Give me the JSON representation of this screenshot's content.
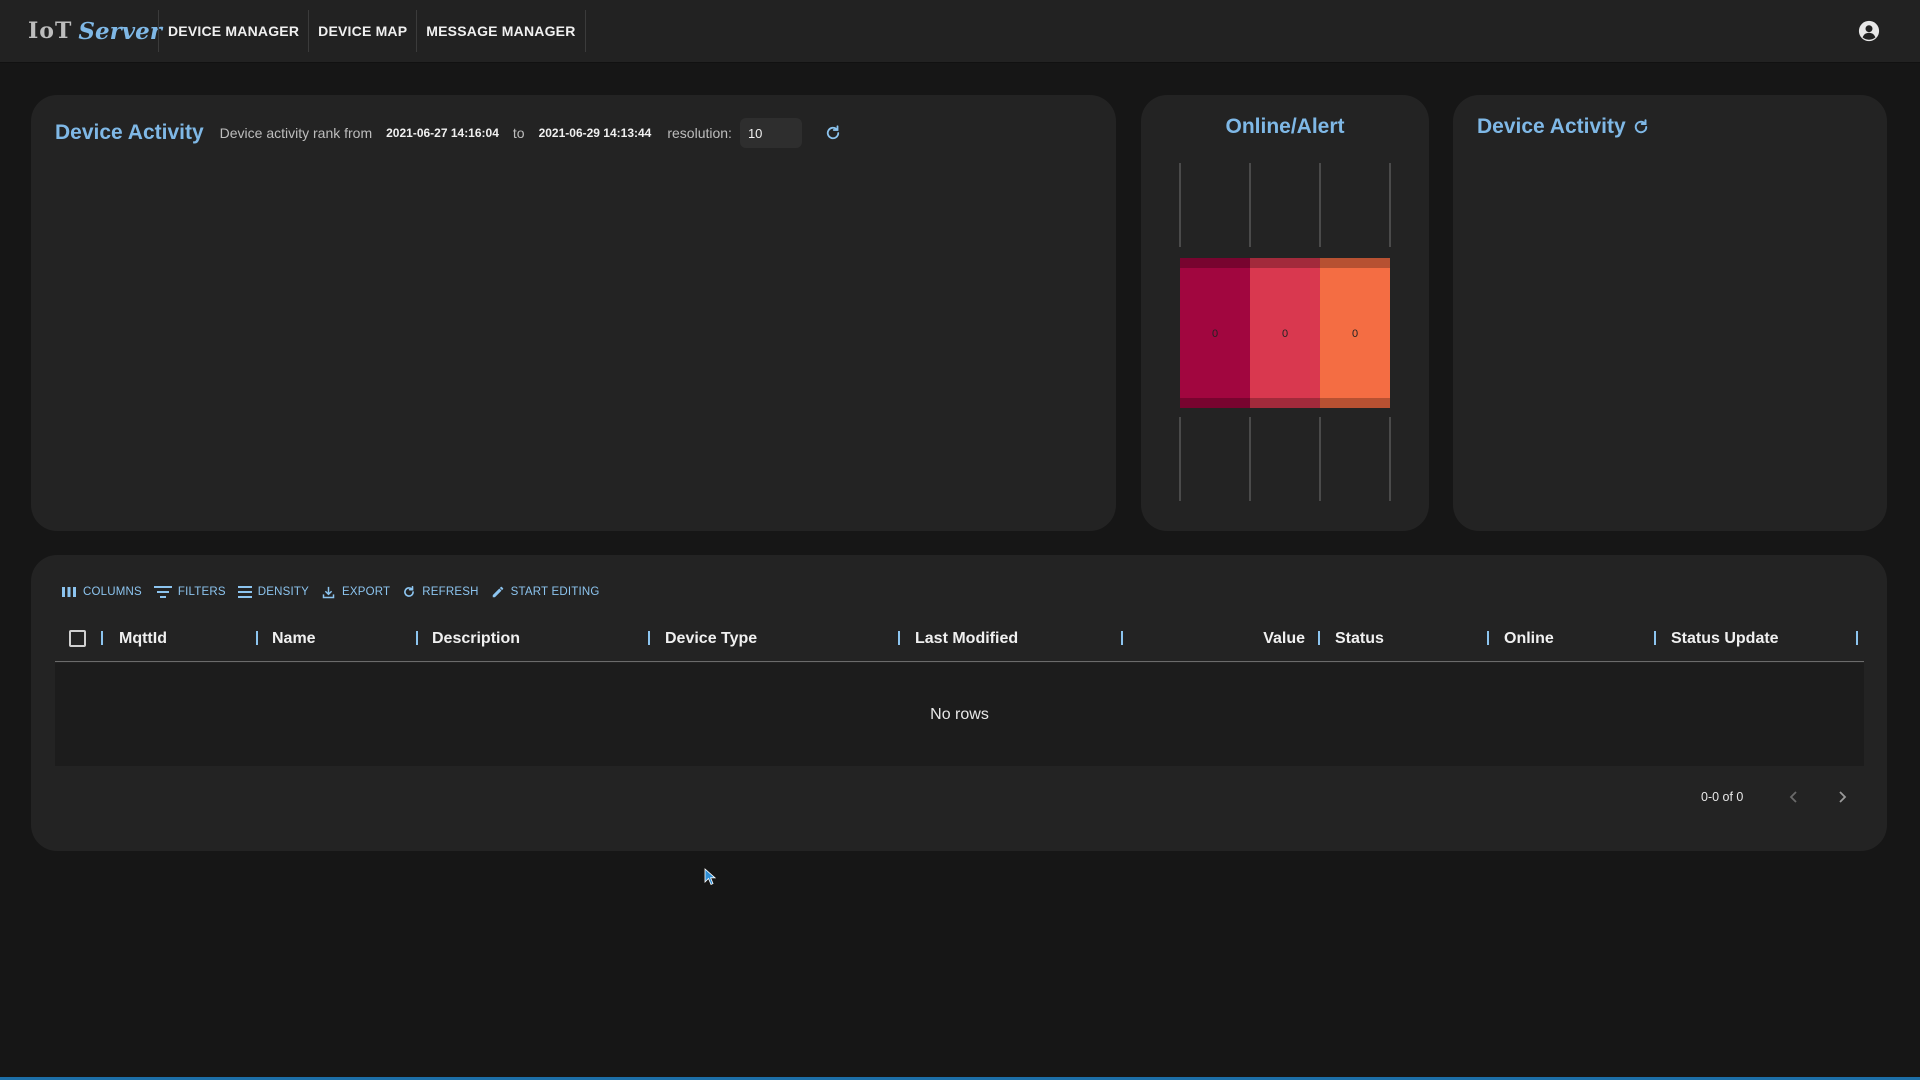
{
  "brand": {
    "prefix": "IoT",
    "suffix": "Server"
  },
  "nav": [
    {
      "label": "DEVICE MANAGER"
    },
    {
      "label": "DEVICE MAP"
    },
    {
      "label": "MESSAGE MANAGER"
    }
  ],
  "account_icon": "account-circle-icon",
  "device_activity": {
    "title": "Device Activity",
    "subtitle": "Device activity rank from",
    "from": "2021-06-27 14:16:04",
    "to_label": "to",
    "to": "2021-06-29 14:13:44",
    "resolution_label": "resolution:",
    "resolution_value": "10",
    "refresh_icon": "refresh-icon"
  },
  "online_alert": {
    "title": "Online/Alert",
    "chart_data": {
      "type": "heatmap",
      "cells": [
        {
          "value": 0,
          "color": "#a1063f"
        },
        {
          "value": 0,
          "color": "#d9384f"
        },
        {
          "value": 0,
          "color": "#f46d43"
        }
      ]
    }
  },
  "device_activity_2": {
    "title": "Device Activity",
    "refresh_icon": "refresh-icon"
  },
  "toolbar": {
    "columns": "COLUMNS",
    "filters": "FILTERS",
    "density": "DENSITY",
    "export": "EXPORT",
    "refresh": "REFRESH",
    "start_editing": "START EDITING"
  },
  "table": {
    "columns": [
      "MqttId",
      "Name",
      "Description",
      "Device Type",
      "Last Modified",
      "Value",
      "Status",
      "Online",
      "Status Update"
    ],
    "empty_text": "No rows",
    "pagination_text": "0-0 of 0"
  }
}
